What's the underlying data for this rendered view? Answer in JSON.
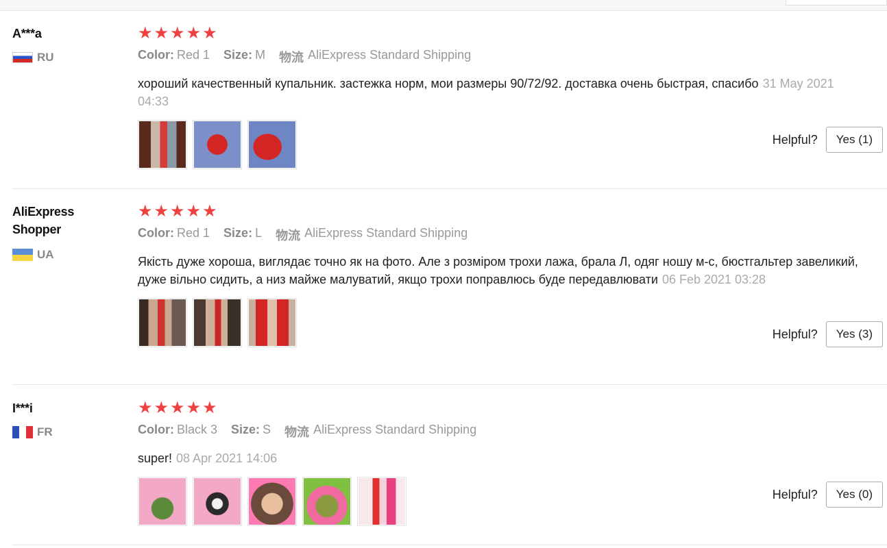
{
  "reviews": [
    {
      "user": "A***a",
      "country_code": "RU",
      "rating": 5,
      "color_label": "Color:",
      "color": "Red 1",
      "size_label": "Size:",
      "size": "M",
      "shipping_label": "物流",
      "shipping": "AliExpress Standard Shipping",
      "text": "хороший качественный купальник. застежка норм, мои размеры 90/72/92. доставка очень быстрая, спасибо",
      "date": "31 May 2021 04:33",
      "photos": [
        "mirror-selfie-red-swimsuit",
        "red-bikini-bottom-on-blue-fabric",
        "red-bikini-on-blue-fabric"
      ],
      "helpful_label": "Helpful?",
      "yes_label": "Yes (1)"
    },
    {
      "user": "AliExpress Shopper",
      "country_code": "UA",
      "rating": 5,
      "color_label": "Color:",
      "color": "Red 1",
      "size_label": "Size:",
      "size": "L",
      "shipping_label": "物流",
      "shipping": "AliExpress Standard Shipping",
      "text": "Якість дуже хороша, виглядає точно як на фото. Але з розміром трохи лажа, брала Л, одяг ношу м-с, бюстгальтер завеликий, дуже вільно сидить, а низ майже малуватий, якщо трохи поправлюсь буде передавлювати",
      "date": "06 Feb 2021 03:28",
      "photos": [
        "mirror-selfie-red-bikini-full",
        "mirror-selfie-red-bikini",
        "red-bikini-closeup"
      ],
      "helpful_label": "Helpful?",
      "yes_label": "Yes (3)"
    },
    {
      "user": "I***i",
      "country_code": "FR",
      "rating": 5,
      "color_label": "Color:",
      "color": "Black 3",
      "size_label": "Size:",
      "size": "S",
      "shipping_label": "物流",
      "shipping": "AliExpress Standard Shipping",
      "text": "super!",
      "date": "08 Apr 2021 14:06",
      "photos": [
        "kermit-hearts-meme",
        "penguin-hearts-meme",
        "girl-hearts-crown-meme",
        "frog-hearts-meme",
        "red-outfit-hearts-meme"
      ],
      "helpful_label": "Helpful?",
      "yes_label": "Yes (0)"
    }
  ],
  "colors": {
    "star": "#f04040",
    "muted": "#999999",
    "flag_ru": [
      "#ffffff",
      "#2b54c8",
      "#d52b1e"
    ],
    "flag_ua": [
      "#5a8fd8",
      "#f5d642"
    ],
    "flag_fr": [
      "#2b4fb5",
      "#ffffff",
      "#e0303a"
    ]
  }
}
